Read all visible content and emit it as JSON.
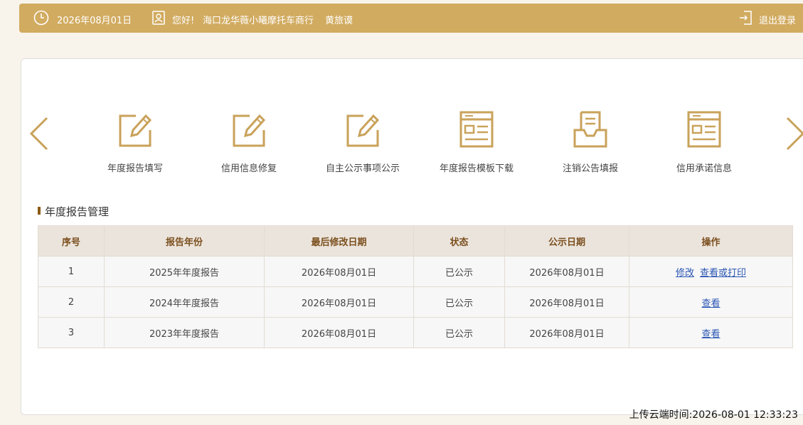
{
  "header": {
    "date": "2026年08月01日",
    "greeting": "您好!",
    "company": "海口龙华薇小曦摩托车商行",
    "username": "黄旅谟",
    "logout_label": "退出登录"
  },
  "menu": {
    "items": [
      {
        "label": "年度报告填写",
        "icon": "edit-icon"
      },
      {
        "label": "信用信息修复",
        "icon": "edit-icon"
      },
      {
        "label": "自主公示事项公示",
        "icon": "edit-icon"
      },
      {
        "label": "年度报告模板下载",
        "icon": "template-icon"
      },
      {
        "label": "注销公告填报",
        "icon": "inbox-icon"
      },
      {
        "label": "信用承诺信息",
        "icon": "template-icon"
      }
    ]
  },
  "section": {
    "title": "年度报告管理"
  },
  "table": {
    "headers": [
      "序号",
      "报告年份",
      "最后修改日期",
      "状态",
      "公示日期",
      "操作"
    ],
    "rows": [
      {
        "no": "1",
        "year": "2025年年度报告",
        "modified": "2026年08月01日",
        "status": "已公示",
        "published": "2026年08月01日",
        "actions": [
          "修改",
          "查看或打印"
        ]
      },
      {
        "no": "2",
        "year": "2024年年度报告",
        "modified": "2026年08月01日",
        "status": "已公示",
        "published": "2026年08月01日",
        "actions": [
          "查看"
        ]
      },
      {
        "no": "3",
        "year": "2023年年度报告",
        "modified": "2026年08月01日",
        "status": "已公示",
        "published": "2026年08月01日",
        "actions": [
          "查看"
        ]
      }
    ]
  },
  "footer": {
    "upload_time": "上传云端时间:2026-08-01 12:33:23"
  },
  "colors": {
    "accent": "#d1ab60",
    "icon": "#c9a25a",
    "section_marker": "#8b5a14",
    "link": "#2a56b3"
  }
}
